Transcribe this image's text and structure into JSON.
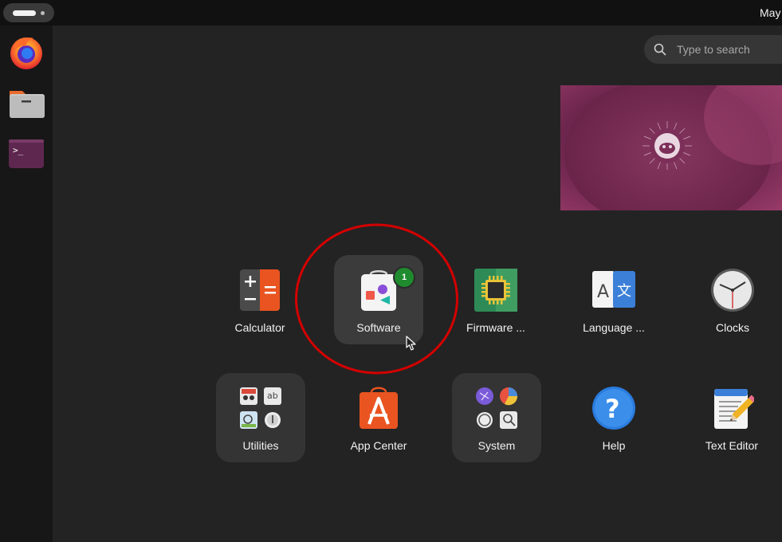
{
  "topbar": {
    "clock": "May"
  },
  "search": {
    "placeholder": "Type to search"
  },
  "dock": {
    "items": [
      {
        "name": "Firefox"
      },
      {
        "name": "Files"
      },
      {
        "name": "Terminal"
      }
    ]
  },
  "apps": {
    "row1": [
      {
        "label": "Calculator"
      },
      {
        "label": "Software",
        "badge": "1"
      },
      {
        "label": "Firmware ..."
      },
      {
        "label": "Language ..."
      },
      {
        "label": "Clocks"
      }
    ],
    "row2": [
      {
        "label": "Utilities"
      },
      {
        "label": "App Center"
      },
      {
        "label": "System"
      },
      {
        "label": "Help"
      },
      {
        "label": "Text Editor"
      }
    ]
  },
  "colors": {
    "accent": "#e95420",
    "annotation": "#d40000",
    "workspace": "#7a2a55"
  }
}
